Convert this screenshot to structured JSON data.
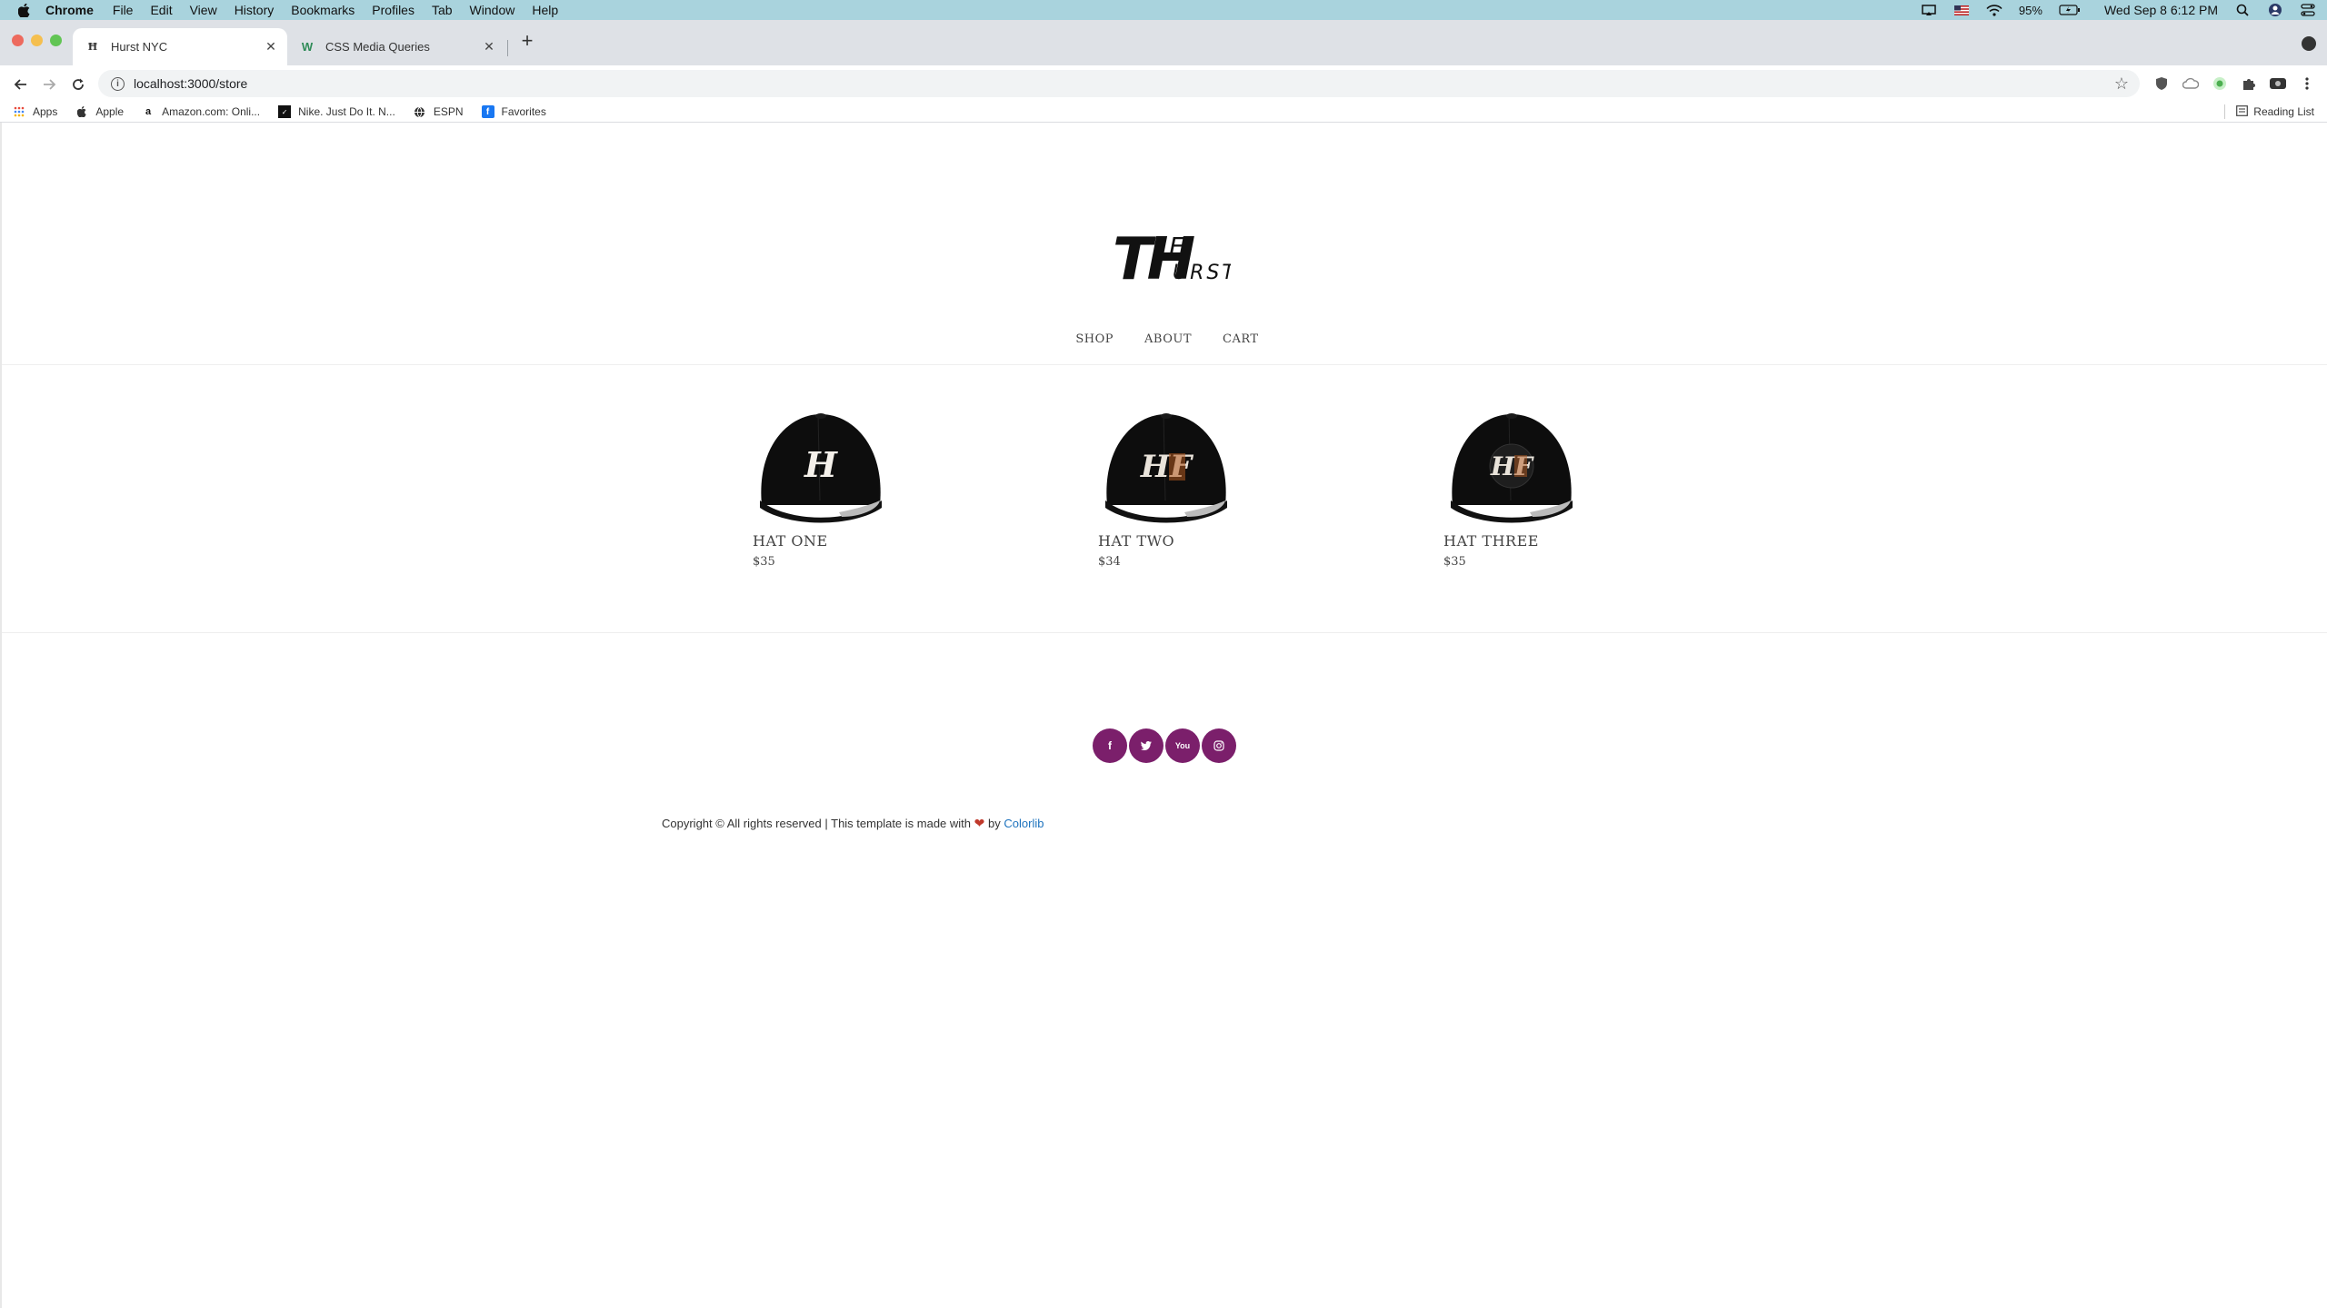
{
  "menubar": {
    "app": "Chrome",
    "items": [
      "File",
      "Edit",
      "View",
      "History",
      "Bookmarks",
      "Profiles",
      "Tab",
      "Window",
      "Help"
    ],
    "battery": "95%",
    "datetime": "Wed Sep 8  6:12 PM"
  },
  "tabs": [
    {
      "title": "Hurst NYC"
    },
    {
      "title": "CSS Media Queries"
    }
  ],
  "address": {
    "url": "localhost:3000/store"
  },
  "bookmarks": {
    "items": [
      "Apps",
      "Apple",
      "Amazon.com: Onli...",
      "Nike. Just Do It. N...",
      "ESPN",
      "Favorites"
    ],
    "reading_list": "Reading List"
  },
  "site": {
    "logo_text_big": "TH",
    "logo_text_e": "E",
    "logo_text_small": "URST",
    "nav": [
      "SHOP",
      "ABOUT",
      "CART"
    ]
  },
  "products": [
    {
      "name": "HAT ONE",
      "price": "$35",
      "monogram": "H"
    },
    {
      "name": "HAT TWO",
      "price": "$34",
      "monogram": "HF"
    },
    {
      "name": "HAT THREE",
      "price": "$35",
      "monogram": "HF"
    }
  ],
  "footer": {
    "social": [
      "facebook-icon",
      "twitter-icon",
      "youtube-icon",
      "instagram-icon"
    ],
    "copyright_pre": "Copyright © All rights reserved | This template is made with",
    "copyright_by": "by",
    "copyright_link": "Colorlib"
  },
  "colors": {
    "menubar": "#a9d3dd",
    "social_bg": "#7b1f6b",
    "link": "#1e73be",
    "heart": "#c0392b"
  }
}
